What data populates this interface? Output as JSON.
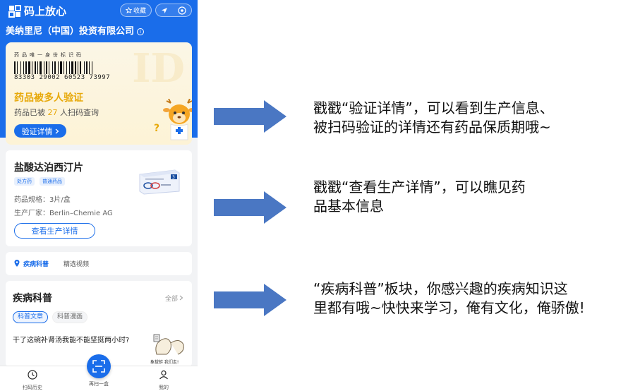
{
  "app": {
    "title": "码上放心",
    "favorite_label": "收藏",
    "company": "美纳里尼（中国）投资有限公司"
  },
  "id_card": {
    "label": "药品唯一身份标识码",
    "watermark": "ID",
    "code": "83303 29002 60523 73997",
    "verify_title": "药品被多人验证",
    "verify_prefix": "药品已被",
    "verify_count": "27",
    "verify_suffix": "人扫码查询",
    "verify_button": "验证详情",
    "question": "?"
  },
  "drug": {
    "name": "盐酸达泊西汀片",
    "tags": [
      "处方药",
      "普通药品"
    ],
    "spec": "药品规格：3片/盒",
    "maker": "生产厂家：Berlin–Chemie AG",
    "detail_button": "查看生产详情"
  },
  "tabs": {
    "active": "疾病科普",
    "other": "精选视频"
  },
  "science": {
    "title": "疾病科普",
    "all": "全部",
    "chips": [
      "科普文章",
      "科普漫画"
    ],
    "article": "干了这碗补肾汤我能不能坚挺两小时?",
    "thumb_caption": "象拔蚌 我们走!"
  },
  "bottom_nav": {
    "history": "扫码历史",
    "scan": "再扫一盒",
    "me": "我的"
  },
  "notes": [
    [
      "戳戳“验证详情”，可以看到生产信息、",
      "被扫码验证的详情还有药品保质期哦~"
    ],
    [
      "戳戳“查看生产详情”，可以瞧见药",
      "品基本信息"
    ],
    [
      "“疾病科普”板块，你感兴趣的疾病知识这",
      "里都有哦~快快来学习，俺有文化，俺骄傲!"
    ]
  ],
  "colors": {
    "brand_blue": "#1a6dea",
    "verify_gold": "#e7a90a",
    "arrow_blue": "#4a77c3"
  }
}
